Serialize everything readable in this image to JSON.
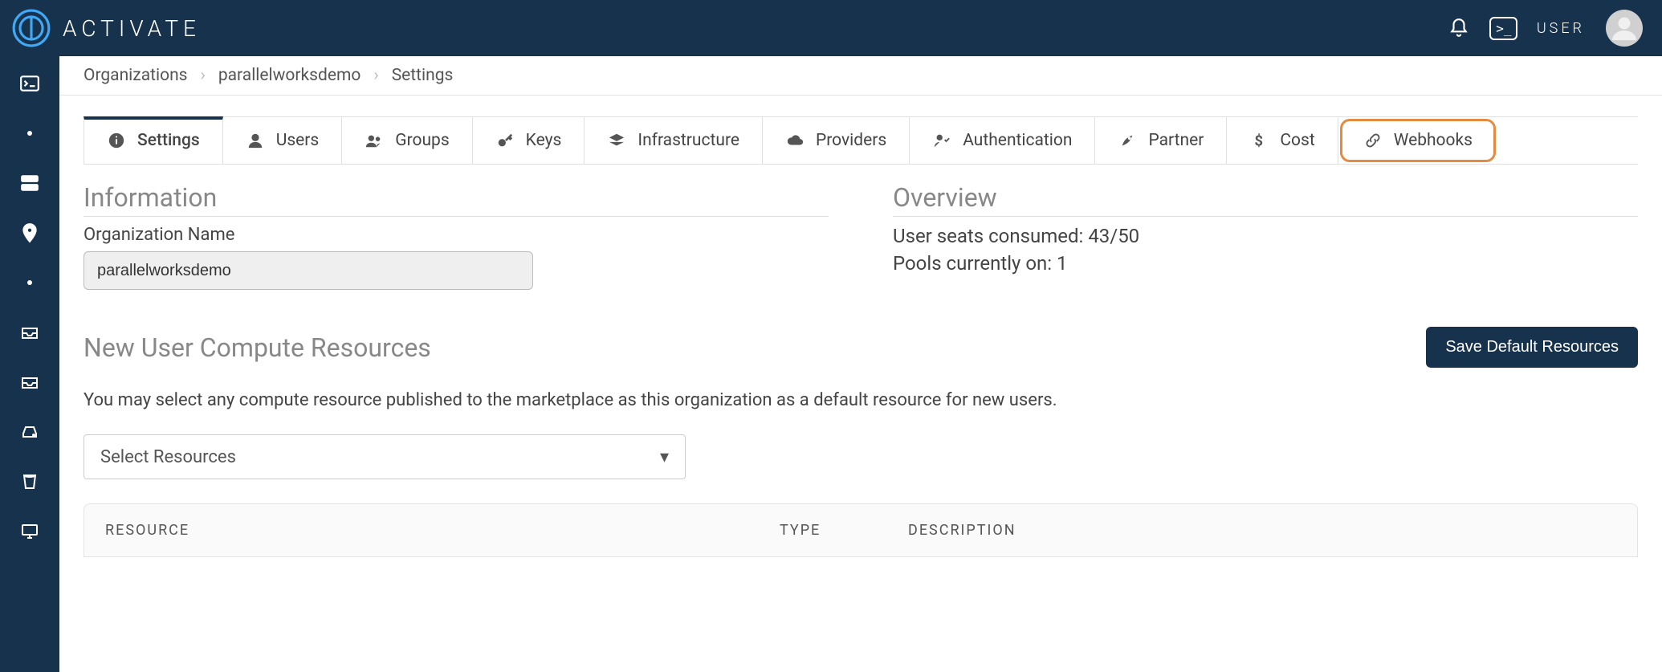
{
  "brand": {
    "name": "ACTIVATE"
  },
  "topbar": {
    "user_label": "USER"
  },
  "breadcrumb": {
    "items": [
      "Organizations",
      "parallelworksdemo",
      "Settings"
    ]
  },
  "tabs": [
    {
      "id": "settings",
      "label": "Settings",
      "icon": "info"
    },
    {
      "id": "users",
      "label": "Users",
      "icon": "user"
    },
    {
      "id": "groups",
      "label": "Groups",
      "icon": "group"
    },
    {
      "id": "keys",
      "label": "Keys",
      "icon": "key"
    },
    {
      "id": "infrastructure",
      "label": "Infrastructure",
      "icon": "layers"
    },
    {
      "id": "providers",
      "label": "Providers",
      "icon": "cloud"
    },
    {
      "id": "authentication",
      "label": "Authentication",
      "icon": "auth"
    },
    {
      "id": "partner",
      "label": "Partner",
      "icon": "rocket"
    },
    {
      "id": "cost",
      "label": "Cost",
      "icon": "dollar"
    },
    {
      "id": "webhooks",
      "label": "Webhooks",
      "icon": "link"
    }
  ],
  "info": {
    "section_title": "Information",
    "org_name_label": "Organization Name",
    "org_name_value": "parallelworksdemo"
  },
  "overview": {
    "section_title": "Overview",
    "seats_line": "User seats consumed: 43/50",
    "pools_line": "Pools currently on: 1"
  },
  "resources": {
    "title": "New User Compute Resources",
    "save_label": "Save Default Resources",
    "hint": "You may select any compute resource published to the marketplace as this organization as a default resource for new users.",
    "select_placeholder": "Select Resources"
  },
  "table": {
    "headers": {
      "resource": "RESOURCE",
      "type": "TYPE",
      "description": "DESCRIPTION"
    }
  }
}
